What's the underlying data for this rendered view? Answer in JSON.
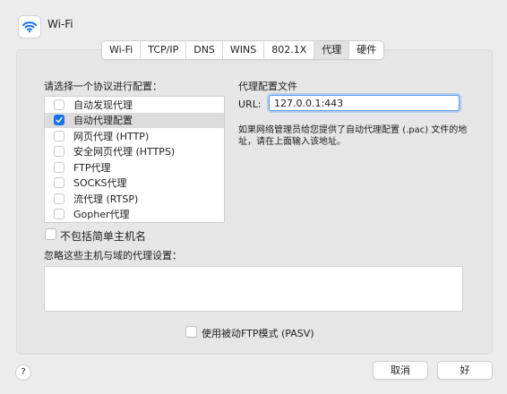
{
  "window": {
    "title": "Wi-Fi",
    "icon": "wifi-icon"
  },
  "tabs": [
    {
      "label": "Wi-Fi"
    },
    {
      "label": "TCP/IP"
    },
    {
      "label": "DNS"
    },
    {
      "label": "WINS"
    },
    {
      "label": "802.1X"
    },
    {
      "label": "代理",
      "active": true
    },
    {
      "label": "硬件"
    }
  ],
  "protocols": {
    "heading": "请选择一个协议进行配置：",
    "items": [
      {
        "label": "自动发现代理",
        "checked": false
      },
      {
        "label": "自动代理配置",
        "checked": true,
        "selected": true
      },
      {
        "label": "网页代理 (HTTP)",
        "checked": false
      },
      {
        "label": "安全网页代理 (HTTPS)",
        "checked": false
      },
      {
        "label": "FTP代理",
        "checked": false
      },
      {
        "label": "SOCKS代理",
        "checked": false
      },
      {
        "label": "流代理 (RTSP)",
        "checked": false
      },
      {
        "label": "Gopher代理",
        "checked": false
      }
    ]
  },
  "config": {
    "heading": "代理配置文件",
    "url_label": "URL:",
    "url_value": "127.0.0.1:443",
    "description": "如果网络管理员给您提供了自动代理配置 (.pac) 文件的地址，请在上面输入该地址。"
  },
  "exclude_simple": {
    "label": "不包括简单主机名",
    "checked": false
  },
  "bypass": {
    "label": "忽略这些主机与域的代理设置：",
    "value": ""
  },
  "passive_ftp": {
    "label": "使用被动FTP模式 (PASV)",
    "checked": false
  },
  "footer": {
    "help": "?",
    "cancel": "取消",
    "ok": "好"
  },
  "colors": {
    "accent": "#1a73e8",
    "focus_ring": "#5b9bf0",
    "background": "#ececec"
  }
}
